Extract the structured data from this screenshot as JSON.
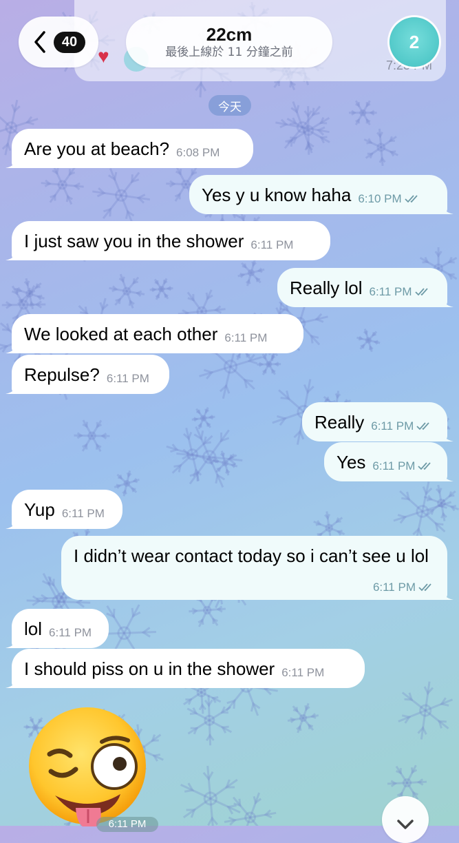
{
  "header": {
    "back_count": "40",
    "title": "22cm",
    "status": "最後上線於 11 分鐘之前",
    "avatar_badge": "2",
    "ghost_time": "7:23 PM"
  },
  "date_separator": "今天",
  "messages": [
    {
      "direction": "in",
      "text": "Are you at beach?",
      "time": "6:08 PM"
    },
    {
      "direction": "out",
      "text": "Yes y u know haha",
      "time": "6:10 PM",
      "read": true
    },
    {
      "direction": "in",
      "text": "I just saw you in the shower",
      "time": "6:11 PM"
    },
    {
      "direction": "out",
      "text": "Really lol",
      "time": "6:11 PM",
      "read": true
    },
    {
      "direction": "in",
      "text": "We looked at each other",
      "time": "6:11 PM"
    },
    {
      "direction": "in",
      "text": "Repulse?",
      "time": "6:11 PM"
    },
    {
      "direction": "out",
      "text": "Really",
      "time": "6:11 PM",
      "read": true
    },
    {
      "direction": "out",
      "text": "Yes",
      "time": "6:11 PM",
      "read": true
    },
    {
      "direction": "in",
      "text": "Yup",
      "time": "6:11 PM"
    },
    {
      "direction": "out",
      "text": "I didn’t wear contact today so i can’t see u lol",
      "time": "6:11 PM",
      "read": true
    },
    {
      "direction": "in",
      "text": "lol",
      "time": "6:11 PM"
    },
    {
      "direction": "in",
      "text": "I should piss on u in the shower",
      "time": "6:11 PM"
    }
  ],
  "sticker": {
    "icon": "winking-tongue-emoji-icon",
    "time": "6:11 PM"
  },
  "icons": {
    "back": "chevron-left-icon",
    "read_receipt": "double-check-icon",
    "scroll": "chevron-down-icon"
  },
  "colors": {
    "outgoing_bubble": "#f0fbfb",
    "incoming_bubble": "#ffffff",
    "avatar": "#52c9c9",
    "date_chip": "#7896d2"
  }
}
